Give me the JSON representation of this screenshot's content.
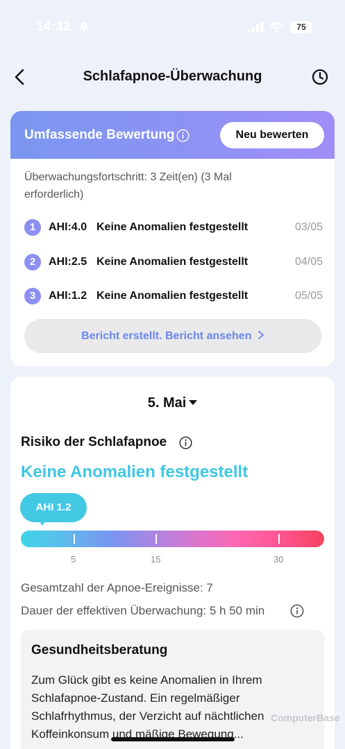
{
  "status_bar": {
    "time": "14:32",
    "battery": "75"
  },
  "header": {
    "title": "Schlafapnoe-Überwachung"
  },
  "assessment": {
    "title": "Umfassende Bewertung",
    "reevaluate_label": "Neu bewerten",
    "progress_text": "Überwachungsfortschritt: 3 Zeit(en) (3 Mal erforderlich)",
    "records": [
      {
        "num": "1",
        "ahi": "AHI:4.0",
        "result": "Keine Anomalien festgestellt",
        "date": "03/05"
      },
      {
        "num": "2",
        "ahi": "AHI:2.5",
        "result": "Keine Anomalien festgestellt",
        "date": "04/05"
      },
      {
        "num": "3",
        "ahi": "AHI:1.2",
        "result": "Keine Anomalien festgestellt",
        "date": "05/05"
      }
    ],
    "report_link": "Bericht erstellt. Bericht ansehen"
  },
  "detail": {
    "date": "5. Mai",
    "risk_title": "Risiko der Schlafapnoe",
    "risk_result": "Keine Anomalien festgestellt",
    "ahi_bubble": "AHI 1.2",
    "scale_ticks": [
      "5",
      "15",
      "30"
    ],
    "apnea_events": "Gesamtzahl der Apnoe-Ereignisse: 7",
    "monitoring_duration": "Dauer der effektiven Überwachung: 5 h 50 min",
    "advice_title": "Gesundheitsberatung",
    "advice_text": "Zum Glück gibt es keine Anomalien in Ihrem Schlafapnoe-Zustand. Ein regelmäßiger Schlafrhythmus, der Verzicht auf nächtlichen Koffeinkonsum und mäßige Bewegung..."
  },
  "colors": {
    "background": "#edf1fa",
    "header_gradient_start": "#7a96f0",
    "header_gradient_end": "#a08ef6",
    "accent_blue": "#6b87e8",
    "result_cyan": "#3ec6e3",
    "number_badge": "#8c8ff2"
  },
  "watermark": "ComputerBase"
}
